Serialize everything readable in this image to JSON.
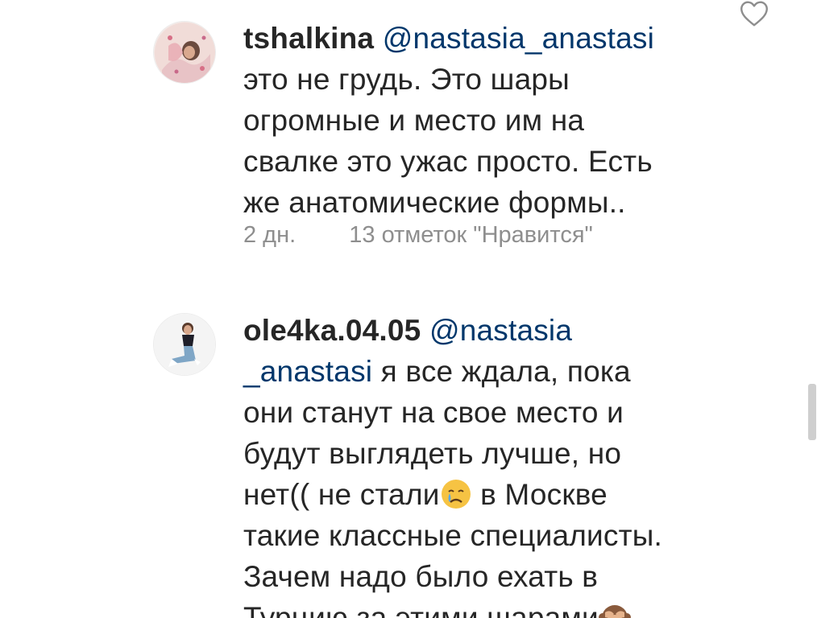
{
  "comments": [
    {
      "username": "tshalkina",
      "mention": "@nastasia_anastasi",
      "text_lines": [
        "это не грудь. Это шары",
        "огромные и место им на",
        "свалке  это ужас просто. Есть",
        "же анатомические формы.."
      ],
      "time": "2 дн.",
      "likes": "13 отметок \"Нравится\"",
      "icons": {
        "avatar": "avatar-photo",
        "like": "heart-outline-icon"
      }
    },
    {
      "username": "ole4ka.04.05",
      "mention_part1": "@nastasia",
      "mention_part2": "_anastasi",
      "text_line1_rest": " я все ждала, пока",
      "text_line2": "они станут на свое место и",
      "text_line3": "будут выглядеть лучше, но",
      "text_line4_a": "нет(( не стали",
      "text_line4_b": " в Москве",
      "text_line5": "такие классные специалисты.",
      "text_line6": "Зачем надо было ехать в",
      "text_line7": "Турцию за этими шарами",
      "icons": {
        "avatar": "avatar-photo",
        "like": "heart-outline-icon",
        "emoji1": "crying-face-emoji",
        "emoji2": "see-no-evil-monkey-emoji"
      }
    }
  ],
  "colors": {
    "text": "#262626",
    "mention": "#00376b",
    "meta": "#8e8e8e",
    "scrollbar": "#cfcfcf"
  }
}
